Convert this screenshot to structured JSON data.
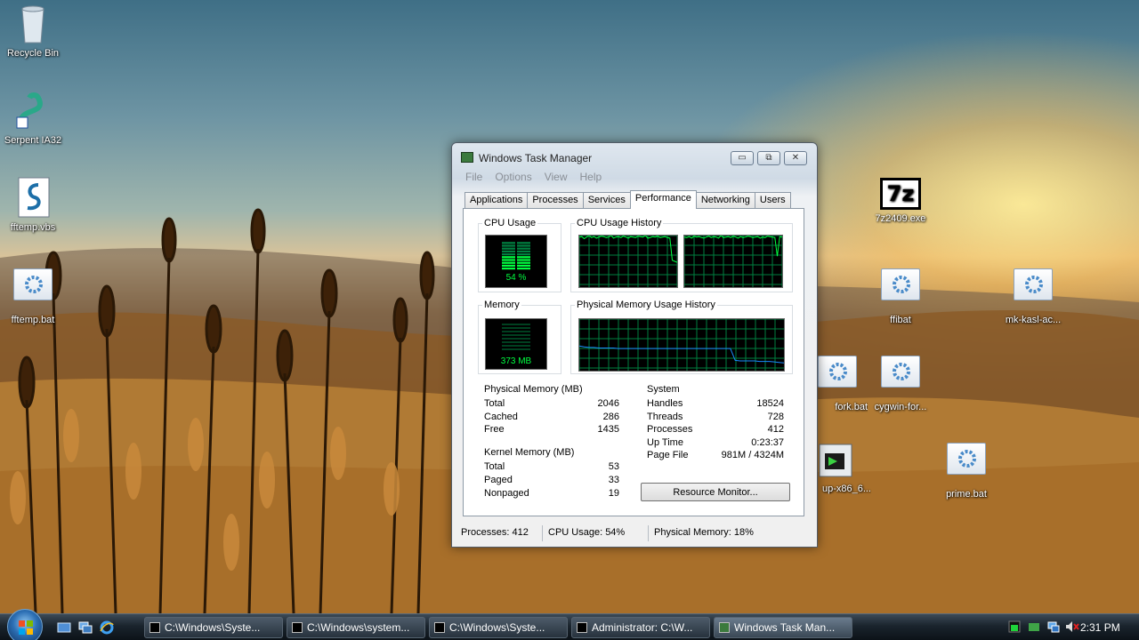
{
  "desktop": {
    "icons": [
      {
        "label": "Recycle Bin",
        "icon": "recycle-bin-icon"
      },
      {
        "label": "Serpent IA32",
        "icon": "serpent-shortcut-icon"
      },
      {
        "label": "fftemp.vbs",
        "icon": "script-file-icon"
      },
      {
        "label": "fftemp.bat",
        "icon": "batch-file-icon"
      },
      {
        "label": "7z2409.exe",
        "icon": "7zip-icon",
        "glyph": "7z"
      },
      {
        "label": "ffibat",
        "icon": "batch-file-icon"
      },
      {
        "label": "mk-kasl-ac...",
        "icon": "batch-file-icon"
      },
      {
        "label": "fork.bat",
        "icon": "batch-file-icon"
      },
      {
        "label": "cygwin-for...",
        "icon": "batch-file-icon"
      },
      {
        "label": "up-x86_6...",
        "icon": "setup-exe-icon"
      },
      {
        "label": "prime.bat",
        "icon": "batch-file-icon"
      }
    ]
  },
  "window": {
    "title": "Windows Task Manager",
    "minimize_glyph": "▭",
    "restore_glyph": "⧉",
    "close_glyph": "✕",
    "menu": [
      "File",
      "Options",
      "View",
      "Help"
    ],
    "tabs": [
      "Applications",
      "Processes",
      "Services",
      "Performance",
      "Networking",
      "Users"
    ],
    "active_tab": "Performance",
    "performance": {
      "cpu_usage": {
        "label": "CPU Usage",
        "value": "54 %",
        "percent": 54
      },
      "cpu_history": {
        "label": "CPU Usage History",
        "core1": [
          97,
          98,
          94,
          97,
          100,
          96,
          98,
          95,
          97,
          99,
          98,
          96,
          97,
          100,
          95,
          97,
          98,
          96,
          99,
          97,
          95,
          98,
          97,
          96,
          99,
          98,
          97,
          100,
          95,
          96,
          98,
          97,
          99,
          96,
          97,
          98,
          96,
          95,
          52,
          50,
          48
        ],
        "core2": [
          97,
          96,
          98,
          95,
          99,
          97,
          98,
          96,
          95,
          97,
          99,
          96,
          98,
          97,
          95,
          100,
          96,
          97,
          98,
          96,
          99,
          97,
          95,
          98,
          96,
          97,
          99,
          98,
          96,
          97,
          98,
          95,
          97,
          96,
          99,
          98,
          97,
          96,
          60,
          98,
          97
        ]
      },
      "memory": {
        "label": "Memory",
        "value": "373 MB"
      },
      "memory_history": {
        "label": "Physical Memory Usage History",
        "values": [
          48,
          46,
          45,
          45,
          44,
          44,
          44,
          44,
          43,
          43,
          43,
          43,
          43,
          43,
          43,
          43,
          43,
          43,
          43,
          43,
          43,
          43,
          43,
          43,
          43,
          43,
          43,
          43,
          43,
          43,
          43,
          43,
          20,
          19,
          19,
          19,
          19,
          18,
          18,
          18,
          17,
          16,
          15
        ]
      },
      "physical_memory": {
        "label": "Physical Memory (MB)",
        "rows": [
          {
            "name": "Total",
            "value": "2046"
          },
          {
            "name": "Cached",
            "value": "286"
          },
          {
            "name": "Free",
            "value": "1435"
          }
        ]
      },
      "kernel_memory": {
        "label": "Kernel Memory (MB)",
        "rows": [
          {
            "name": "Total",
            "value": "53"
          },
          {
            "name": "Paged",
            "value": "33"
          },
          {
            "name": "Nonpaged",
            "value": "19"
          }
        ]
      },
      "system": {
        "label": "System",
        "rows": [
          {
            "name": "Handles",
            "value": "18524"
          },
          {
            "name": "Threads",
            "value": "728"
          },
          {
            "name": "Processes",
            "value": "412"
          },
          {
            "name": "Up Time",
            "value": "0:23:37"
          },
          {
            "name": "Page File",
            "value": "981M / 4324M"
          }
        ]
      },
      "resource_monitor_label": "Resource Monitor..."
    },
    "status": {
      "processes": "Processes: 412",
      "cpu": "CPU Usage: 54%",
      "memory": "Physical Memory: 18%"
    }
  },
  "taskbar": {
    "buttons": [
      "C:\\Windows\\Syste...",
      "C:\\Windows\\system...",
      "C:\\Windows\\Syste...",
      "Administrator: C:\\W...",
      "Windows Task Man..."
    ],
    "clock": "2:31 PM"
  },
  "colors": {
    "graph_green": "#00ff40",
    "graph_grid": "#008040",
    "memory_line": "#1a8cff"
  }
}
